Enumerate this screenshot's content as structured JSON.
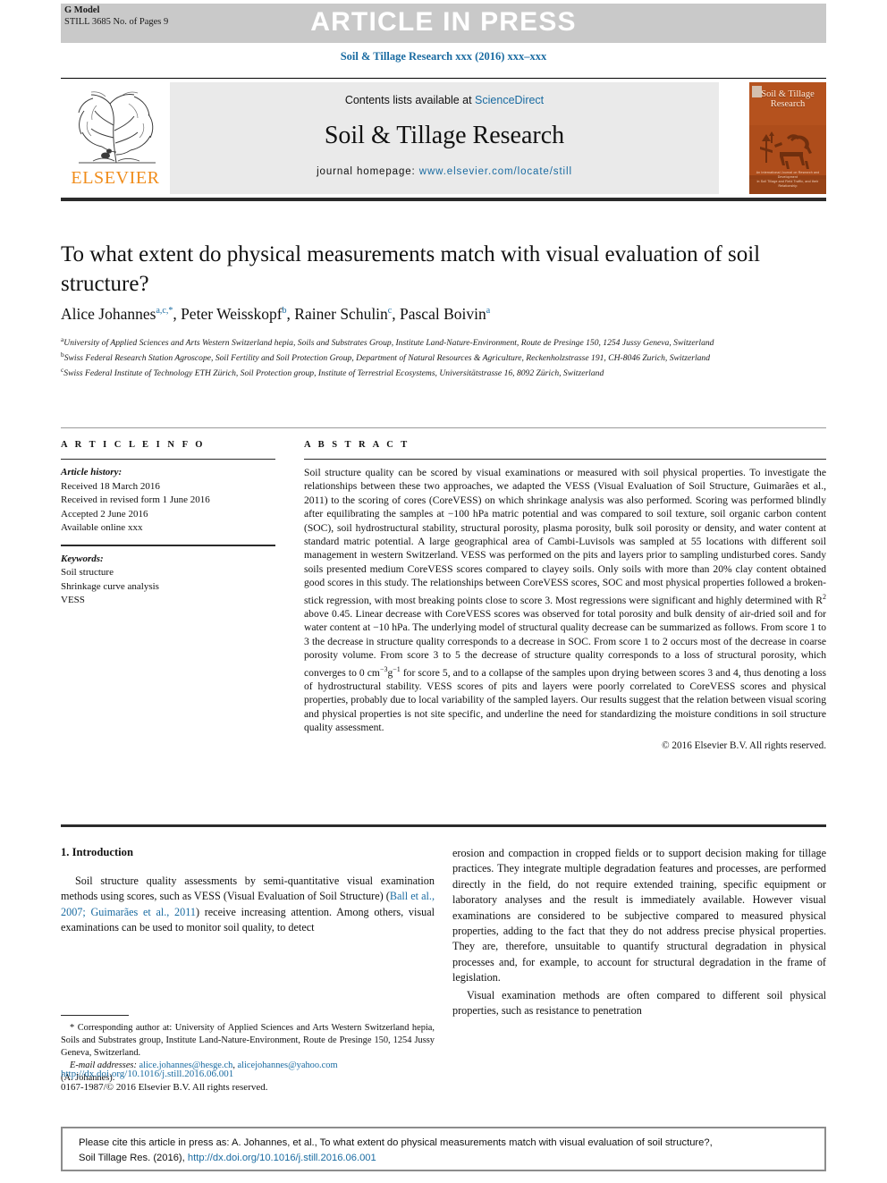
{
  "header": {
    "g_model": "G Model",
    "still_line": "STILL 3685 No. of Pages 9",
    "article_in_press": "ARTICLE IN PRESS",
    "running_head": "Soil & Tillage Research xxx (2016) xxx–xxx"
  },
  "masthead": {
    "contents_prefix": "Contents lists available at ",
    "contents_link": "ScienceDirect",
    "journal_title": "Soil & Tillage Research",
    "homepage_prefix": "journal homepage: ",
    "homepage_link": "www.elsevier.com/locate/still",
    "publisher": "ELSEVIER",
    "cover_title_line1": "Soil & Tillage",
    "cover_title_line2": "Research",
    "cover_footer_line1": "An International Journal on Research and Development",
    "cover_footer_line2": "in Soil Tillage and Field Traffic, and their Relationship"
  },
  "article": {
    "title": "To what extent do physical measurements match with visual evaluation of soil structure?",
    "authors": [
      {
        "name": "Alice Johannes",
        "marks": "a,c,*"
      },
      {
        "name": "Peter Weisskopf",
        "marks": "b"
      },
      {
        "name": "Rainer Schulin",
        "marks": "c"
      },
      {
        "name": "Pascal Boivin",
        "marks": "a"
      }
    ],
    "affiliations": [
      {
        "mark": "a",
        "text": "University of Applied Sciences and Arts Western Switzerland hepia, Soils and Substrates Group, Institute Land-Nature-Environment, Route de Presinge 150, 1254 Jussy Geneva, Switzerland"
      },
      {
        "mark": "b",
        "text": "Swiss Federal Research Station Agroscope, Soil Fertility and Soil Protection Group, Department of Natural Resources & Agriculture, Reckenholzstrasse 191, CH-8046 Zurich, Switzerland"
      },
      {
        "mark": "c",
        "text": "Swiss Federal Institute of Technology ETH Zürich, Soil Protection group, Institute of Terrestrial Ecosystems, Universitätstrasse 16, 8092 Zürich, Switzerland"
      }
    ]
  },
  "article_info": {
    "heading": "A R T I C L E   I N F O",
    "history_label": "Article history:",
    "history": [
      "Received 18 March 2016",
      "Received in revised form 1 June 2016",
      "Accepted 2 June 2016",
      "Available online xxx"
    ],
    "keywords_label": "Keywords:",
    "keywords": [
      "Soil structure",
      "Shrinkage curve analysis",
      "VESS"
    ]
  },
  "abstract": {
    "heading": "A B S T R A C T",
    "text": "Soil structure quality can be scored by visual examinations or measured with soil physical properties. To investigate the relationships between these two approaches, we adapted the VESS (Visual Evaluation of Soil Structure, Guimarães et al., 2011) to the scoring of cores (CoreVESS) on which shrinkage analysis was also performed. Scoring was performed blindly after equilibrating the samples at −100 hPa matric potential and was compared to soil texture, soil organic carbon content (SOC), soil hydrostructural stability, structural porosity, plasma porosity, bulk soil porosity or density, and water content at standard matric potential. A large geographical area of Cambi-Luvisols was sampled at 55 locations with different soil management in western Switzerland. VESS was performed on the pits and layers prior to sampling undisturbed cores. Sandy soils presented medium CoreVESS scores compared to clayey soils. Only soils with more than 20% clay content obtained good scores in this study. The relationships between CoreVESS scores, SOC and most physical properties followed a broken-stick regression, with most breaking points close to score 3. Most regressions were significant and highly determined with R",
    "text_sup1": "2",
    "text2": " above 0.45. Linear decrease with CoreVESS scores was observed for total porosity and bulk density of air-dried soil and for water content at −10 hPa. The underlying model of structural quality decrease can be summarized as follows. From score 1 to 3 the decrease in structure quality corresponds to a decrease in SOC. From score 1 to 2 occurs most of the decrease in coarse porosity volume. From score 3 to 5 the decrease of structure quality corresponds to a loss of structural porosity, which converges to 0 cm",
    "text_sup2": "−3",
    "text3": "g",
    "text_sup3": "−1",
    "text4": " for score 5, and to a collapse of the samples upon drying between scores 3 and 4, thus denoting a loss of hydrostructural stability. VESS scores of pits and layers were poorly correlated to CoreVESS scores and physical properties, probably due to local variability of the sampled layers. Our results suggest that the relation between visual scoring and physical properties is not site specific, and underline the need for standardizing the moisture conditions in soil structure quality assessment.",
    "copyright": "© 2016 Elsevier B.V. All rights reserved."
  },
  "body": {
    "section_heading": "1. Introduction",
    "left_para1_a": "Soil structure quality assessments by semi-quantitative visual examination methods using scores, such as VESS (Visual Evaluation of Soil Structure) (",
    "left_para1_link": "Ball et al., 2007; Guimarães et al., 2011",
    "left_para1_b": ") receive increasing attention. Among others, visual examinations can be used to monitor soil quality, to detect",
    "right_para1": "erosion and compaction in cropped fields or to support decision making for tillage practices. They integrate multiple degradation features and processes, are performed directly in the field, do not require extended training, specific equipment or laboratory analyses and the result is immediately available. However visual examinations are considered to be subjective compared to measured physical properties, adding to the fact that they do not address precise physical properties. They are, therefore, unsuitable to quantify structural degradation in physical processes and, for example, to account for structural degradation in the frame of legislation.",
    "right_para2": "Visual examination methods are often compared to different soil physical properties, such as resistance to penetration"
  },
  "footnote": {
    "star": "*",
    "text": "Corresponding author at: University of Applied Sciences and Arts Western Switzerland hepia, Soils and Substrates group, Institute Land-Nature-Environment, Route de Presinge 150, 1254 Jussy Geneva, Switzerland.",
    "email_label": "E-mail addresses:",
    "email1": "alice.johannes@hesge.ch",
    "email_sep": ", ",
    "email2": "alicejohannes@yahoo.com",
    "email_suffix": "(A. Johannes)."
  },
  "footer": {
    "doi": "http://dx.doi.org/10.1016/j.still.2016.06.001",
    "issn": "0167-1987/© 2016 Elsevier B.V. All rights reserved."
  },
  "cite_box": {
    "line1": "Please cite this article in press as: A. Johannes, et al., To what extent do physical measurements match with visual evaluation of soil structure?,",
    "line2_prefix": "Soil Tillage Res. (2016), ",
    "line2_link": "http://dx.doi.org/10.1016/j.still.2016.06.001"
  },
  "colors": {
    "link": "#1a6ba1",
    "band": "#c9c9c9",
    "mast_bg": "#eaeaea",
    "elsevier_orange": "#f08c1a",
    "cover_orange": "#b5521e"
  }
}
